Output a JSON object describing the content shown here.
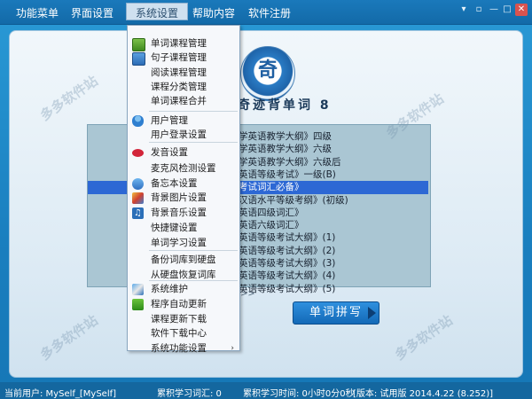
{
  "menubar": {
    "items": [
      "功能菜单",
      "界面设置",
      "系统设置",
      "帮助内容",
      "软件注册"
    ]
  },
  "window_controls": [
    "▾",
    "▫",
    "—",
    "□",
    "✕"
  ],
  "logo": {
    "char": "奇"
  },
  "app_title": "奇迹背单词 8",
  "list": {
    "items": [
      "学英语教学大纲》四级",
      "学英语教学大纲》六级",
      "学英语教学大纲》六级后",
      "英语等级考试》一级(B)",
      "考试词汇必备》",
      "汉语水平等级考纲》(初级)",
      "英语四级词汇》",
      "英语六级词汇》",
      "英语等级考试大纲》(1)",
      "英语等级考试大纲》(2)",
      "英语等级考试大纲》(3)",
      "英语等级考试大纲》(4)",
      "英语等级考试大纲》(5)"
    ],
    "selected_index": 4
  },
  "pager_text": ">>",
  "spell_button": "单词拼写",
  "dropdown": {
    "items": [
      {
        "label": "单词课程管理",
        "icon": "book-icon"
      },
      {
        "label": "句子课程管理",
        "icon": "notebook-icon"
      },
      {
        "label": "阅读课程管理",
        "icon": ""
      },
      {
        "label": "课程分类管理",
        "icon": ""
      },
      {
        "label": "单词课程合并",
        "icon": ""
      },
      {
        "label": "用户管理",
        "icon": "user-icon"
      },
      {
        "label": "用户登录设置",
        "icon": ""
      },
      {
        "label": "发音设置",
        "icon": "lips-icon"
      },
      {
        "label": "麦克风检测设置",
        "icon": ""
      },
      {
        "label": "备忘本设置",
        "icon": "memo-icon"
      },
      {
        "label": "背景图片设置",
        "icon": "picture-icon"
      },
      {
        "label": "背景音乐设置",
        "icon": "music-icon"
      },
      {
        "label": "快捷键设置",
        "icon": ""
      },
      {
        "label": "单词学习设置",
        "icon": ""
      },
      {
        "label": "备份词库到硬盘",
        "icon": ""
      },
      {
        "label": "从硬盘恢复词库",
        "icon": ""
      },
      {
        "label": "系统维护",
        "icon": "tools-icon"
      },
      {
        "label": "程序自动更新",
        "icon": "download-arrow-icon"
      },
      {
        "label": "课程更新下载",
        "icon": ""
      },
      {
        "label": "软件下载中心",
        "icon": ""
      },
      {
        "label": "系统功能设置",
        "icon": "",
        "submenu": true
      }
    ]
  },
  "status": {
    "user": "当前用户: MySelf_[MySelf]",
    "words": "累积学习词汇: 0",
    "time": "累积学习时间: 0小时0分0秒",
    "version": "[版本: 试用版  2014.4.22 (8.252)]"
  },
  "watermark": "多多软件站"
}
